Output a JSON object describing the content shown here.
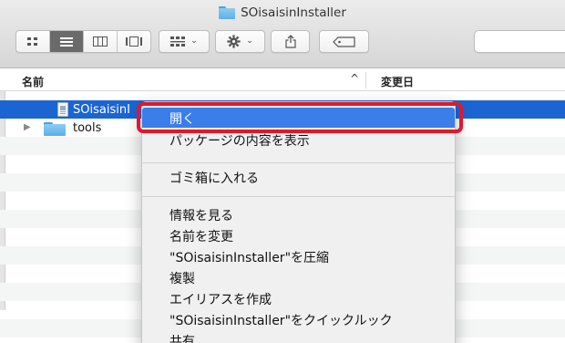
{
  "window": {
    "title": "SOisaisinInstaller",
    "title_icon": "folder-icon"
  },
  "toolbar": {
    "view_buttons": [
      {
        "name": "icon-view",
        "icon": "grid-icon",
        "active": false
      },
      {
        "name": "list-view",
        "icon": "list-icon",
        "active": true
      },
      {
        "name": "column-view",
        "icon": "columns-icon",
        "active": false
      },
      {
        "name": "gallery-view",
        "icon": "gallery-icon",
        "active": false
      }
    ],
    "arrange_icon": "arrange-icon",
    "action_icon": "gear-icon",
    "share_icon": "share-icon",
    "tag_icon": "tag-icon",
    "chevron": "⌄"
  },
  "list_header": {
    "name_label": "名前",
    "sort_indicator": "^",
    "date_label": "変更日"
  },
  "rows": [
    {
      "name": "SOisaisinI",
      "selected": true,
      "icon": "app-file-icon"
    },
    {
      "name": "tools",
      "selected": false,
      "icon": "folder-icon",
      "disclosure": "▶"
    }
  ],
  "context_menu": {
    "items": [
      {
        "label": "開く",
        "highlighted": true
      },
      {
        "label": "パッケージの内容を表示"
      },
      {
        "label": "ゴミ箱に入れる"
      },
      {
        "label": "情報を見る"
      },
      {
        "label": "名前を変更"
      },
      {
        "label": "\"SOisaisinInstaller\"を圧縮"
      },
      {
        "label": "複製"
      },
      {
        "label": "エイリアスを作成"
      },
      {
        "label": "\"SOisaisinInstaller\"をクイックルック"
      },
      {
        "label": "共有"
      }
    ]
  },
  "colors": {
    "selection": "#1b65d3",
    "menu_highlight": "#3b7de9",
    "annotation_red": "#e0182d",
    "folder_blue": "#5eafe6"
  }
}
